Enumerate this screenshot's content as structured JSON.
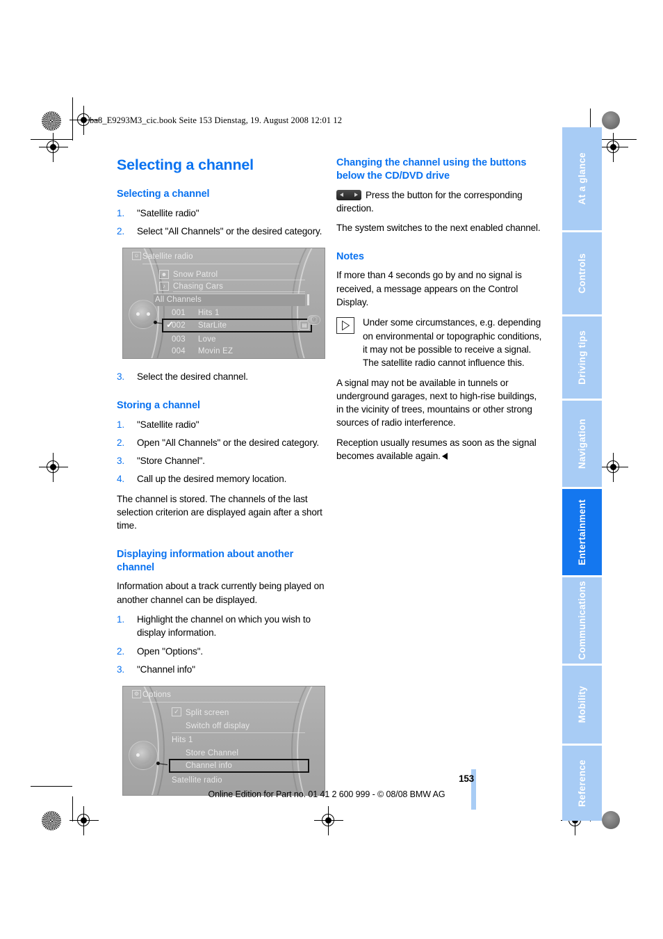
{
  "print_header": "ba8_E9293M3_cic.book  Seite 153  Dienstag, 19. August 2008  12:01 12",
  "colors": {
    "heading_blue": "#0a72f0",
    "tab_blue": "#a8ccf5",
    "tab_active_blue": "#1477ef"
  },
  "page": {
    "title": "Selecting a channel",
    "number": "153",
    "footer": "Online Edition for Part no. 01 41 2 600 999 - © 08/08 BMW AG"
  },
  "sidebar": {
    "tabs": [
      {
        "label": "At a glance",
        "active": false
      },
      {
        "label": "Controls",
        "active": false
      },
      {
        "label": "Driving tips",
        "active": false
      },
      {
        "label": "Navigation",
        "active": false
      },
      {
        "label": "Entertainment",
        "active": true
      },
      {
        "label": "Communications",
        "active": false
      },
      {
        "label": "Mobility",
        "active": false
      },
      {
        "label": "Reference",
        "active": false
      }
    ]
  },
  "left_column": {
    "section_selecting": {
      "heading": "Selecting a channel",
      "steps": [
        {
          "num": "1.",
          "text": "\"Satellite radio\""
        },
        {
          "num": "2.",
          "text": "Select \"All Channels\" or the desired category."
        }
      ],
      "step_after_image": {
        "num": "3.",
        "text": "Select the desired channel."
      }
    },
    "screenshot_channels": {
      "title": "Satellite radio",
      "title_icon": "person-icon",
      "artist_row": {
        "label": "Snow Patrol",
        "icon": "artist-icon"
      },
      "track_row": {
        "label": "Chasing Cars",
        "icon": "track-icon"
      },
      "category": "All Channels",
      "channels": [
        {
          "number": "001",
          "name": "Hits 1",
          "selected": false,
          "checked": false
        },
        {
          "number": "002",
          "name": "StarLite",
          "selected": true,
          "checked": true
        },
        {
          "number": "003",
          "name": "Love",
          "selected": false,
          "checked": false
        },
        {
          "number": "004",
          "name": "Movin EZ",
          "selected": false,
          "checked": false
        }
      ]
    },
    "section_storing": {
      "heading": "Storing a channel",
      "steps": [
        {
          "num": "1.",
          "text": "\"Satellite radio\""
        },
        {
          "num": "2.",
          "text": "Open \"All Channels\" or the desired category."
        },
        {
          "num": "3.",
          "text": "\"Store Channel\"."
        },
        {
          "num": "4.",
          "text": "Call up the desired memory location."
        }
      ],
      "paragraph": "The channel is stored. The channels of the last selection criterion are displayed again after a short time."
    },
    "section_displaying": {
      "heading": "Displaying information about another channel",
      "paragraph": "Information about a track currently being played on another channel can be displayed.",
      "steps": [
        {
          "num": "1.",
          "text": "Highlight the channel on which you wish to display information."
        },
        {
          "num": "2.",
          "text": "Open \"Options\"."
        },
        {
          "num": "3.",
          "text": "\"Channel info\""
        }
      ]
    },
    "screenshot_options": {
      "title": "Options",
      "title_icon": "options-icon",
      "items": [
        {
          "label": "Split screen",
          "checkbox": true,
          "checked": true,
          "selected": false
        },
        {
          "label": "Switch off display",
          "checkbox": false,
          "checked": false,
          "selected": false
        },
        {
          "label": "Hits 1",
          "checkbox": false,
          "checked": false,
          "selected": false,
          "group": true
        },
        {
          "label": "Store Channel",
          "checkbox": false,
          "checked": false,
          "selected": false
        },
        {
          "label": "Channel info",
          "checkbox": false,
          "checked": false,
          "selected": true
        },
        {
          "label": "Satellite radio",
          "checkbox": false,
          "checked": false,
          "selected": false,
          "group": true
        }
      ]
    }
  },
  "right_column": {
    "section_changing": {
      "heading": "Changing the channel using the buttons below the CD/DVD drive",
      "icon": "left-right-button-icon",
      "paragraph_1": "Press the button for the corresponding direction.",
      "paragraph_2": "The system switches to the next enabled channel."
    },
    "section_notes": {
      "heading": "Notes",
      "paragraph_1": "If more than 4 seconds go by and no signal is received, a message appears on the Control Display.",
      "note_icon": "triangle-note-icon",
      "note_paragraph_1": "Under some circumstances, e.g. depending on environmental or topographic conditions, it may not be possible to receive a signal. The satellite radio cannot influence this.",
      "note_paragraph_2": "A signal may not be available in tunnels or underground garages, next to high-rise buildings, in the vicinity of trees, mountains or other strong sources of radio interference.",
      "note_paragraph_3": "Reception usually resumes as soon as the signal becomes available again.",
      "end_marker": "end-of-note-marker"
    }
  }
}
